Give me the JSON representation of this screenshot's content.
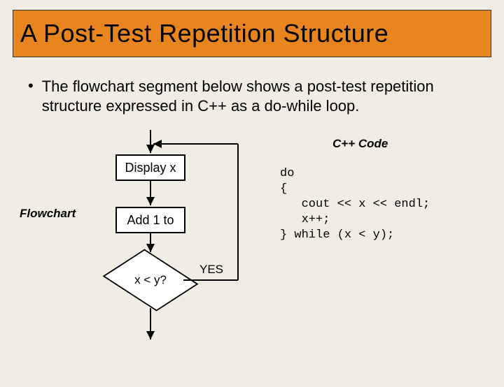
{
  "title": "A Post-Test Repetition Structure",
  "bullet_text": "The flowchart segment below shows a post-test repetition structure expressed in C++ as a do-while loop.",
  "labels": {
    "flowchart": "Flowchart",
    "code": "C++ Code",
    "yes": "YES"
  },
  "flowchart": {
    "box_display": "Display x",
    "box_add": "Add 1 to",
    "decision": "x < y?"
  },
  "code": "do\n{\n   cout << x << endl;\n   x++;\n} while (x < y);"
}
